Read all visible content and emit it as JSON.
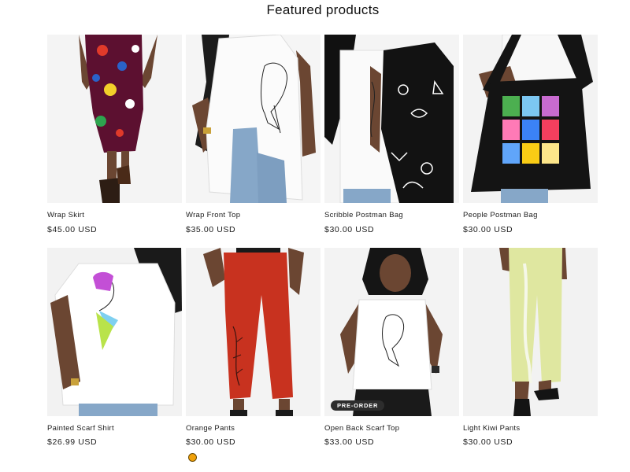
{
  "section": {
    "title": "Featured products"
  },
  "products": [
    {
      "title": "Wrap Skirt",
      "price": "$45.00 USD"
    },
    {
      "title": "Wrap Front Top",
      "price": "$35.00 USD"
    },
    {
      "title": "Scribble Postman Bag",
      "price": "$30.00 USD"
    },
    {
      "title": "People Postman Bag",
      "price": "$30.00 USD"
    },
    {
      "title": "Painted Scarf Shirt",
      "price": "$26.99 USD"
    },
    {
      "title": "Orange Pants",
      "price": "$30.00 USD",
      "swatch_color": "#f0a10b"
    },
    {
      "title": "Open Back Scarf Top",
      "price": "$33.00 USD",
      "badge": "PRE-ORDER"
    },
    {
      "title": "Light Kiwi Pants",
      "price": "$30.00 USD"
    }
  ],
  "colors": {
    "skin": "#6b4632",
    "swatch": "#f0a10b",
    "orange_pants": "#c8321f",
    "kiwi_pants": "#dfe7a0"
  }
}
